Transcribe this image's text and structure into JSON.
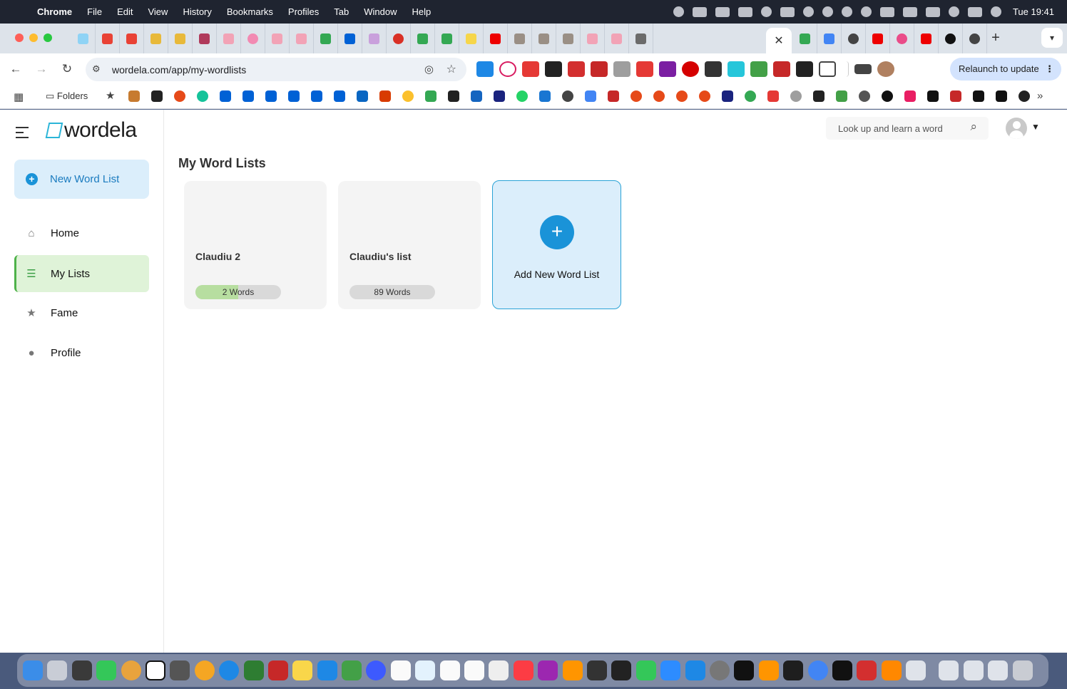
{
  "menubar": {
    "app_name": "Chrome",
    "items": [
      "File",
      "Edit",
      "View",
      "History",
      "Bookmarks",
      "Profiles",
      "Tab",
      "Window",
      "Help"
    ],
    "clock": "Tue 19:41"
  },
  "tabs": {
    "close_glyph": "✕",
    "new_tab_glyph": "+"
  },
  "toolbar": {
    "url": "wordela.com/app/my-wordlists",
    "relaunch_label": "Relaunch to update"
  },
  "bookmarks": {
    "folder_label": "Folders"
  },
  "app": {
    "logo_text": "wordela",
    "new_list_label": "New Word List",
    "nav": [
      {
        "label": "Home",
        "icon": "home-icon",
        "active": false
      },
      {
        "label": "My Lists",
        "icon": "list-icon",
        "active": true
      },
      {
        "label": "Fame",
        "icon": "star-icon",
        "active": false
      },
      {
        "label": "Profile",
        "icon": "person-icon",
        "active": false
      }
    ],
    "search_placeholder": "Look up and learn a word",
    "page_title": "My Word Lists",
    "lists": [
      {
        "name": "Claudiu 2",
        "count_label": "2 Words",
        "progress": 0.5
      },
      {
        "name": "Claudiu's list",
        "count_label": "89 Words",
        "progress": 0
      }
    ],
    "add_card_label": "Add New Word List"
  },
  "colors": {
    "accent": "#1a93d8",
    "active_nav": "#dff3d8",
    "active_bar": "#4eb24a"
  }
}
